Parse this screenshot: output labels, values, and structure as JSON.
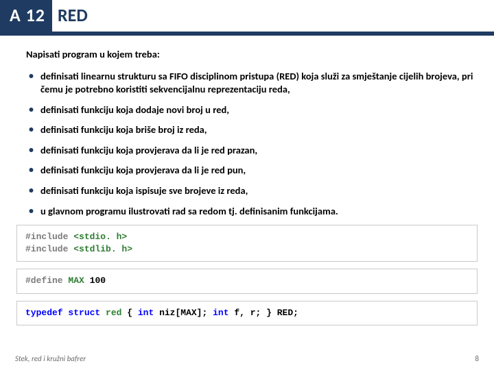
{
  "header": {
    "badge": "A 12",
    "title": "RED"
  },
  "intro": "Napisati program u kojem treba:",
  "bullets": [
    "definisati linearnu strukturu sa FIFO disciplinom pristupa (RED) koja služi za smještanje cijelih brojeva, pri čemu je potrebno koristiti sekvencijalnu reprezentaciju reda,",
    "definisati funkciju koja dodaje novi broj u red,",
    "definisati funkciju koja briše broj iz reda,",
    "definisati funkciju koja provjerava da li je red prazan,",
    "definisati funkciju koja provjerava da li je red pun,",
    "definisati funkciju koja ispisuje sve brojeve iz reda,",
    "u glavnom programu ilustrovati rad sa redom tj. definisanim funkcijama."
  ],
  "code1": {
    "l1_a": "#include ",
    "l1_b": "<stdio. h>",
    "l2_a": "#include ",
    "l2_b": "<stdlib. h>"
  },
  "code2": {
    "l1_a": "#define ",
    "l1_b": "MAX ",
    "l1_c": "100"
  },
  "code3": {
    "a": "typedef ",
    "b": "struct ",
    "c": "red ",
    "d": "{ ",
    "e": "int ",
    "f": "niz[MAX]; ",
    "g": "int ",
    "h": "f, r; } RED;"
  },
  "footer": {
    "text": "Stek, red i kružni bafrer",
    "page": "8"
  }
}
